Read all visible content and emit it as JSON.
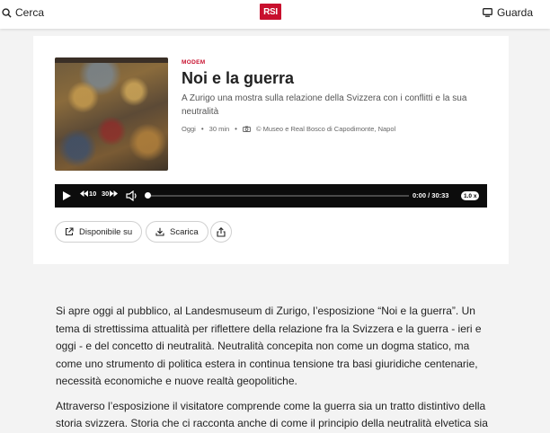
{
  "header": {
    "search_label": "Cerca",
    "logo_text": "RSI",
    "watch_label": "Guarda"
  },
  "episode": {
    "category": "MODEM",
    "title": "Noi e la guerra",
    "subtitle": "A Zurigo una mostra sulla relazione della Svizzera con i conflitti e la sua neutralità",
    "date": "Oggi",
    "duration": "30 min",
    "credit": "© Museo e Real Bosco di Capodimonte, Napol"
  },
  "player": {
    "rewind_label": "10",
    "forward_label": "30",
    "current_time": "0:00",
    "total_time": "30:33",
    "time_separator": "/",
    "speed": "1.0 x",
    "progress": 0
  },
  "actions": {
    "available_on": "Disponibile su",
    "download": "Scarica"
  },
  "article": {
    "paragraphs": [
      "Si apre oggi al pubblico, al Landesmuseum di Zurigo, l’esposizione “Noi e la guerra”. Un tema di strettissima attualità per riflettere della relazione fra la Svizzera e la guerra - ieri e oggi - e del concetto di neutralità. Neutralità concepita non come un dogma statico, ma come uno strumento di politica estera in continua tensione tra basi giuridiche centenarie, necessità economiche e nuove realtà geopolitiche.",
      "Attraverso l’esposizione il visitatore comprende come la guerra sia un tratto distintivo della storia svizzera. Storia che ci racconta anche di come il principio della neutralità elvetica sia"
    ]
  },
  "colors": {
    "brand_red": "#c8102e",
    "player_bg": "#0c0c0c",
    "page_bg": "#f3f3f3"
  },
  "icons": {
    "search": "search-icon",
    "tv": "tv-icon",
    "camera": "camera-icon",
    "play": "play-icon",
    "rewind": "rewind-icon",
    "forward": "forward-icon",
    "volume": "volume-icon",
    "external_link": "external-link-icon",
    "download": "download-icon",
    "share": "share-icon"
  }
}
